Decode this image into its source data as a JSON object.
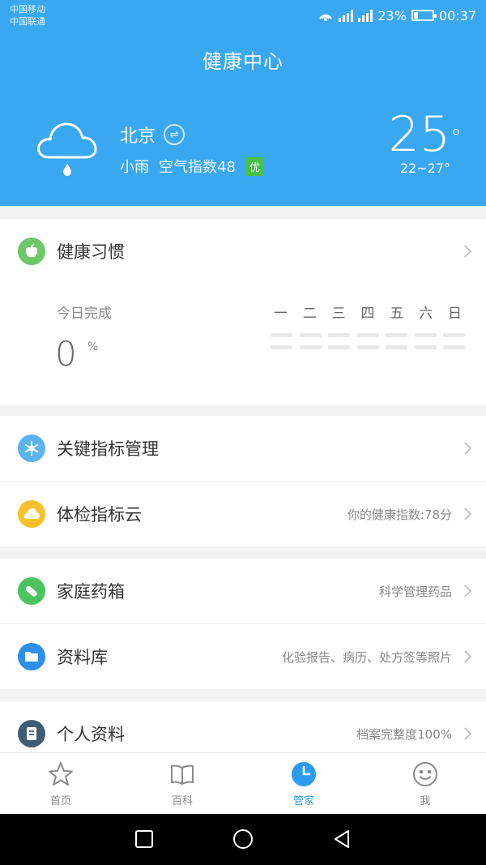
{
  "status_bar": {
    "carrier_1": "中国移动",
    "carrier_2": "中国联通",
    "battery": "23%",
    "battery_level": 0.23,
    "time": "00:37"
  },
  "header": {
    "title": "健康中心"
  },
  "weather": {
    "icon": "rain-cloud-icon",
    "city": "北京",
    "condition": "小雨",
    "aqi_text": "空气指数48",
    "aqi_badge": "优",
    "temp": "25",
    "temp_unit": "°",
    "range": "22~27°"
  },
  "habits": {
    "label": "健康习惯",
    "today_label": "今日完成",
    "today_value": "0",
    "today_unit": "%",
    "days": [
      "一",
      "二",
      "三",
      "四",
      "五",
      "六",
      "日"
    ]
  },
  "menu": [
    {
      "label": "关键指标管理",
      "hint": "",
      "icon": "snowflake-icon",
      "color": "#5bb4ef"
    },
    {
      "label": "体检指标云",
      "hint": "你的健康指数:78分",
      "icon": "cloud-icon",
      "color": "#f6c12a"
    },
    {
      "label": "家庭药箱",
      "hint": "科学管理药品",
      "icon": "pill-icon",
      "color": "#4cc35e"
    },
    {
      "label": "资料库",
      "hint": "化验报告、病历、处方签等照片",
      "icon": "folder-icon",
      "color": "#2e8fea"
    },
    {
      "label": "个人资料",
      "hint": "档案完整度100%",
      "icon": "document-icon",
      "color": "#3f5c73"
    }
  ],
  "tabs": [
    {
      "label": "首页",
      "icon": "star-icon"
    },
    {
      "label": "百科",
      "icon": "book-icon"
    },
    {
      "label": "管家",
      "icon": "clock-icon",
      "active": true
    },
    {
      "label": "我",
      "icon": "smiley-icon"
    }
  ],
  "colors": {
    "header_blue": "#3aa8f1",
    "accent": "#2d9cf0",
    "habit_green": "#6bc96a",
    "aqi_green": "#48c04c"
  }
}
